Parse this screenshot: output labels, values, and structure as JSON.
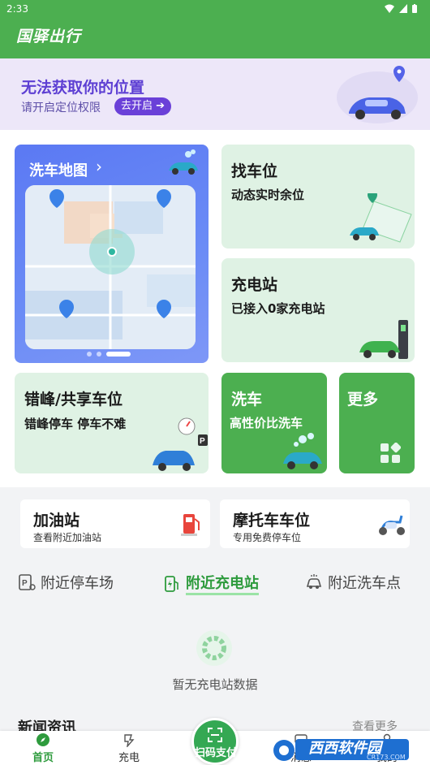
{
  "status": {
    "time": "2:33"
  },
  "app": {
    "title": "国驿出行"
  },
  "location": {
    "title": "无法获取你的位置",
    "subtitle": "请开启定位权限",
    "button": "去开启"
  },
  "cards": {
    "wash_map": {
      "title": "洗车地图"
    },
    "find_spot": {
      "title": "找车位",
      "subtitle": "动态实时余位"
    },
    "charge_station": {
      "title": "充电站",
      "subtitle": "已接入0家充电站"
    },
    "peak_spot": {
      "title": "错峰/共享车位",
      "subtitle": "错峰停车  停车不难"
    },
    "car_wash": {
      "title": "洗车",
      "subtitle": "高性价比洗车"
    },
    "more": {
      "title": "更多"
    }
  },
  "services": [
    {
      "title": "加油站",
      "subtitle": "查看附近加油站"
    },
    {
      "title": "摩托车车位",
      "subtitle": "专用免费停车位"
    }
  ],
  "tabs": [
    {
      "label": "附近停车场",
      "active": false
    },
    {
      "label": "附近充电站",
      "active": true
    },
    {
      "label": "附近洗车点",
      "active": false
    }
  ],
  "empty_state": {
    "text": "暂无充电站数据"
  },
  "news": {
    "title": "新闻资讯",
    "more": "查看更多"
  },
  "navbar": {
    "items": [
      {
        "label": "首页",
        "icon": "home-compass-icon",
        "active": true
      },
      {
        "label": "充电",
        "icon": "charge-icon",
        "active": false
      },
      {
        "label": "扫码支付",
        "icon": "scan-icon",
        "active": false
      },
      {
        "label": "消息",
        "icon": "message-icon",
        "active": false
      },
      {
        "label": "我的",
        "icon": "profile-icon",
        "active": false
      }
    ]
  },
  "watermark": {
    "brand": "西西软件园",
    "url": "CR173.COM"
  },
  "colors": {
    "primary": "#4caf50",
    "accent_purple": "#6a40d8",
    "card_bg": "#dff2e4",
    "map_card": "#6b8cf6"
  }
}
